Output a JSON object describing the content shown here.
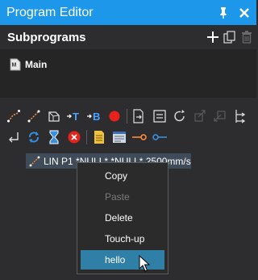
{
  "window": {
    "title": "Program Editor"
  },
  "subprograms": {
    "header": "Subprograms",
    "items": [
      {
        "label": "Main"
      }
    ]
  },
  "toolbar": {
    "row1_icons": [
      "move-joint-icon",
      "move-linear-icon",
      "move-circular-icon",
      "set-tool-icon",
      "set-base-icon",
      "stop-record-icon",
      "call-program-icon",
      "comment-icon",
      "loop-icon",
      "jump-icon",
      "rejoin-icon",
      "branch-icon"
    ],
    "row2_icons": [
      "return-icon",
      "refresh-icon",
      "wait-icon",
      "error-icon",
      "note-icon",
      "display-icon",
      "set-output-icon",
      "get-input-icon"
    ]
  },
  "program": {
    "lines": [
      {
        "text": "LIN P1 *NULL* *NULL* 2500mm/s"
      }
    ]
  },
  "context_menu": {
    "items": [
      {
        "label": "Copy",
        "enabled": true
      },
      {
        "label": "Paste",
        "enabled": false
      },
      {
        "label": "Delete",
        "enabled": true
      },
      {
        "label": "Touch-up",
        "enabled": true
      },
      {
        "label": "hello",
        "enabled": true,
        "highlighted": true
      }
    ]
  },
  "colors": {
    "accent": "#1c97ea",
    "background": "#2d2d30",
    "highlight": "#2f7fa6"
  }
}
